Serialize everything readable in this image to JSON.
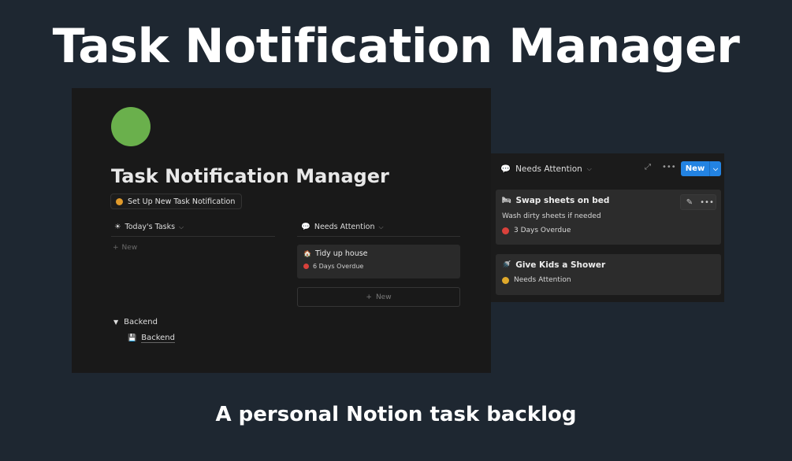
{
  "hero": {
    "title": "Task Notification Manager",
    "subtitle": "A personal Notion task backlog"
  },
  "page": {
    "icon": "green-circle-icon",
    "title": "Task Notification Manager",
    "setup_button": "Set Up New Task Notification",
    "todays_tasks": {
      "header": "Today's Tasks",
      "new_label": "New"
    },
    "needs_attention": {
      "header": "Needs Attention",
      "card": {
        "title": "Tidy up house",
        "status": "6 Days Overdue"
      },
      "new_label": "New"
    },
    "backend_toggle": "Backend",
    "backend_link": "Backend"
  },
  "panel": {
    "header": "Needs Attention",
    "new_button": "New",
    "cards": [
      {
        "title": "Swap sheets on bed",
        "description": "Wash dirty sheets if needed",
        "status": "3 Days Overdue"
      },
      {
        "title": "Give Kids a Shower",
        "status": "Needs Attention"
      }
    ]
  },
  "colors": {
    "background": "#1e2731",
    "page": "#191919",
    "icon_green": "#6ab04c",
    "overdue_red": "#d9413b",
    "attention_yellow": "#e0a92b",
    "setup_orange": "#e09a2b",
    "accent_blue": "#2383e2"
  }
}
